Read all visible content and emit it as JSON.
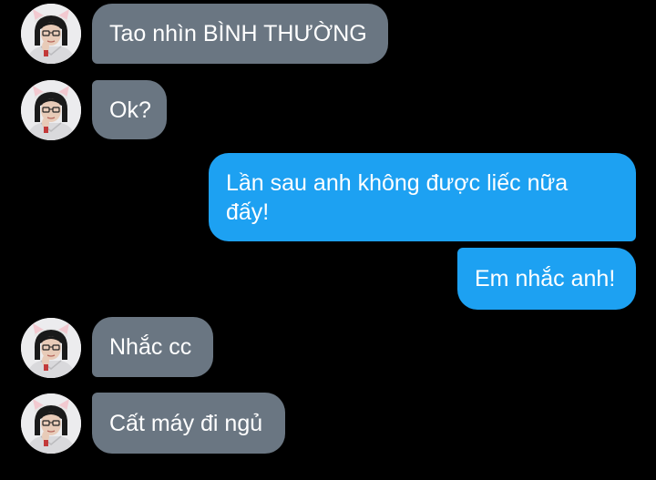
{
  "messages": [
    {
      "direction": "received",
      "text": "Tao nhìn BÌNH THƯỜNG"
    },
    {
      "direction": "received",
      "text": "Ok?"
    },
    {
      "direction": "sent",
      "text": "Lần sau anh không được liếc nữa đấy!"
    },
    {
      "direction": "sent",
      "text": "Em nhắc anh!"
    },
    {
      "direction": "received",
      "text": "Nhắc cc"
    },
    {
      "direction": "received",
      "text": "Cất máy đi ngủ"
    }
  ],
  "colors": {
    "background": "#000000",
    "received_bubble": "#6a7682",
    "sent_bubble": "#1da1f2",
    "text": "#ffffff"
  }
}
